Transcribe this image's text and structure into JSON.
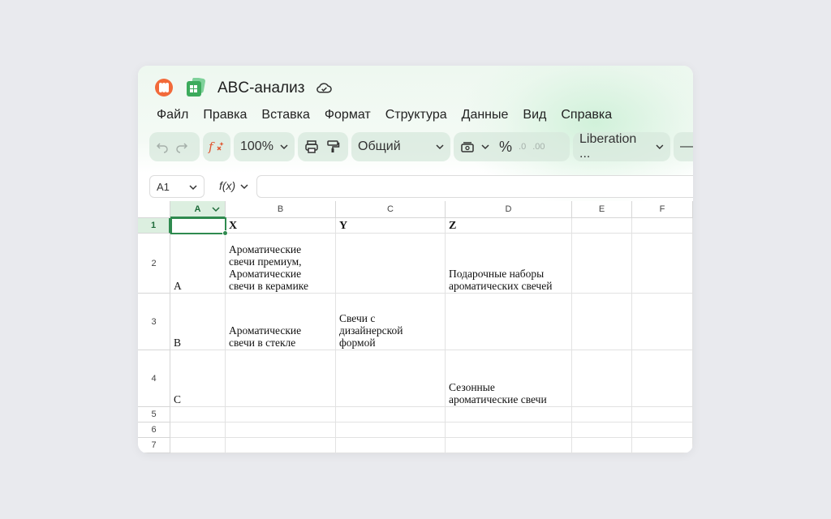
{
  "app": {
    "title": "ABC-анализ",
    "accent": "#2f8a4f",
    "logo_color": "#f26a3a",
    "sheets_color": "#3cab5c"
  },
  "menu": [
    "Файл",
    "Правка",
    "Вставка",
    "Формат",
    "Структура",
    "Данные",
    "Вид",
    "Справка"
  ],
  "toolbar": {
    "undo_icon": "undo-icon",
    "redo_icon": "redo-icon",
    "function_icon": "function-icon",
    "zoom": "100%",
    "print_icon": "print-icon",
    "paint_format_icon": "paint-format-icon",
    "number_format": "Общий",
    "currency_icon": "currency-icon",
    "percent": "%",
    "decrease_decimal": ".0",
    "increase_decimal": ".00",
    "font": "Liberation ...",
    "minus": "—"
  },
  "formula_bar": {
    "cell_ref": "A1",
    "fx_label": "f(x)",
    "value": ""
  },
  "sheet": {
    "columns": [
      "A",
      "B",
      "C",
      "D",
      "E",
      "F"
    ],
    "rows": [
      "1",
      "2",
      "3",
      "4",
      "5",
      "6",
      "7"
    ],
    "cells": {
      "B1": "X",
      "C1": "Y",
      "D1": "Z",
      "A2": "A",
      "B2": "Ароматические\nсвечи премиум,\nАроматические\nсвечи в керамике",
      "D2": "Подарочные наборы\nароматических свечей",
      "A3": "B",
      "B3": "Ароматические\nсвечи в стекле",
      "C3": "Свечи с\nдизайнерской\nформой",
      "A4": "C",
      "D4": "Сезонные\nароматические свечи"
    }
  }
}
